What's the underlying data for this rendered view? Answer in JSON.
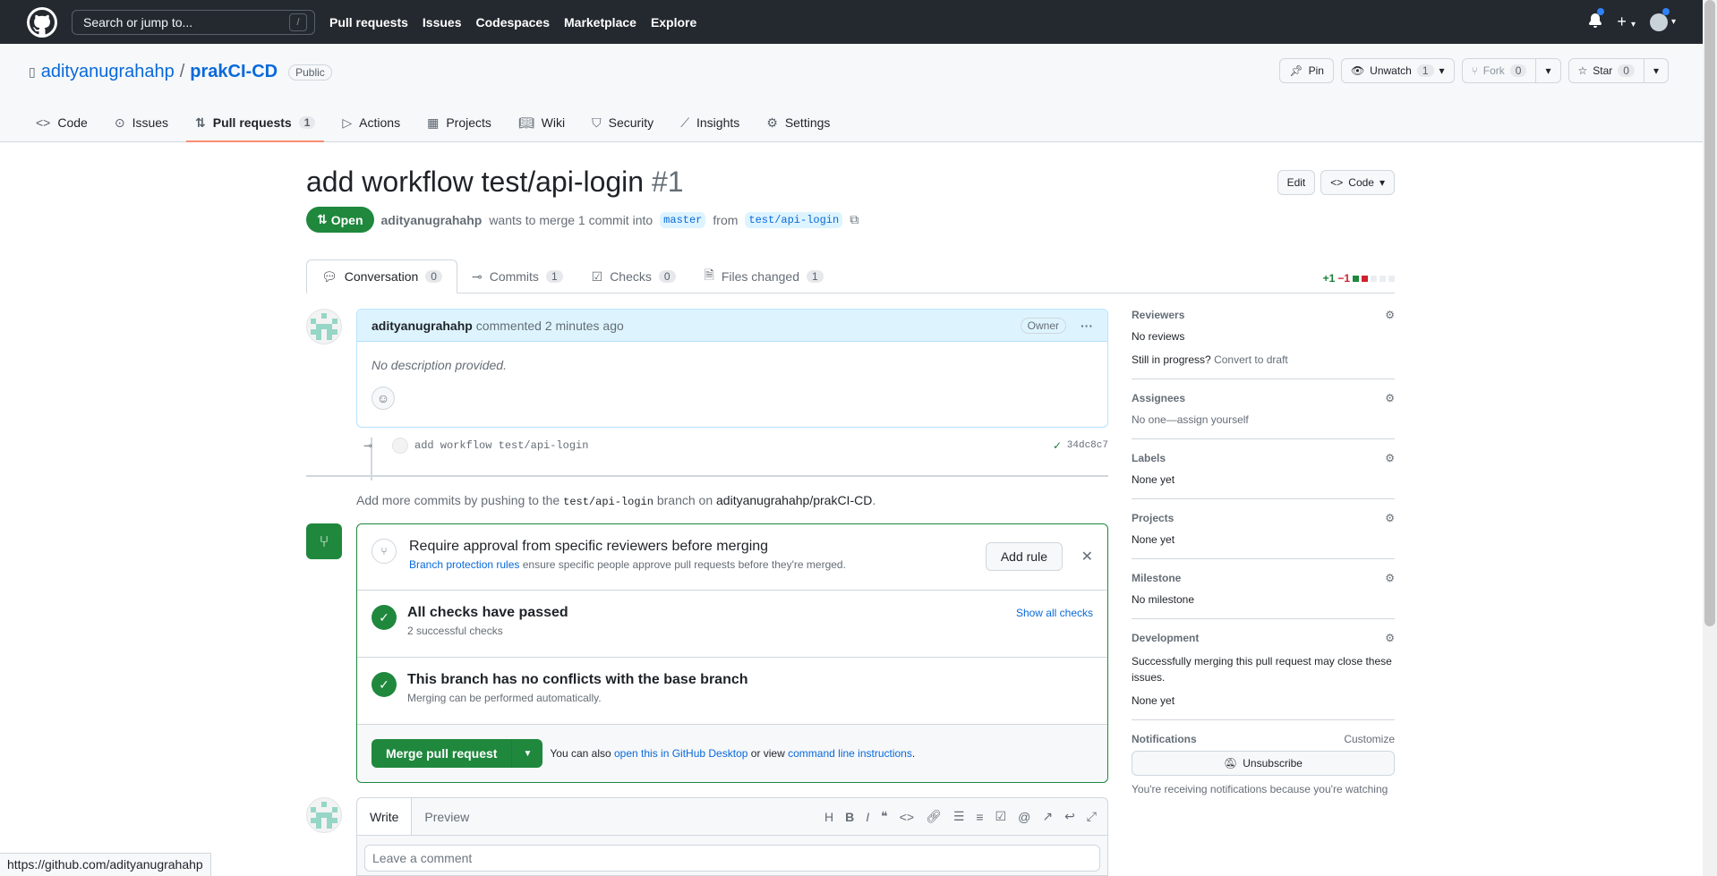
{
  "header": {
    "search_placeholder": "Search or jump to...",
    "search_key": "/",
    "nav": [
      "Pull requests",
      "Issues",
      "Codespaces",
      "Marketplace",
      "Explore"
    ]
  },
  "repo": {
    "owner": "adityanugrahahp",
    "name": "prakCI-CD",
    "visibility": "Public",
    "pin_label": "Pin",
    "watch_label": "Unwatch",
    "watch_count": "1",
    "fork_label": "Fork",
    "fork_count": "0",
    "star_label": "Star",
    "star_count": "0"
  },
  "tabs": [
    {
      "label": "Code"
    },
    {
      "label": "Issues"
    },
    {
      "label": "Pull requests",
      "count": "1"
    },
    {
      "label": "Actions"
    },
    {
      "label": "Projects"
    },
    {
      "label": "Wiki"
    },
    {
      "label": "Security"
    },
    {
      "label": "Insights"
    },
    {
      "label": "Settings"
    }
  ],
  "pr": {
    "title": "add workflow test/api-login",
    "number": "#1",
    "edit_label": "Edit",
    "code_label": "Code",
    "state": "Open",
    "author": "adityanugrahahp",
    "merge_text": "wants to merge 1 commit into",
    "base": "master",
    "from_text": "from",
    "head": "test/api-login",
    "tabs": [
      {
        "label": "Conversation",
        "count": "0"
      },
      {
        "label": "Commits",
        "count": "1"
      },
      {
        "label": "Checks",
        "count": "0"
      },
      {
        "label": "Files changed",
        "count": "1"
      }
    ],
    "diff_add": "+1",
    "diff_del": "−1"
  },
  "comment": {
    "author": "adityanugrahahp",
    "time": "commented 2 minutes ago",
    "badge": "Owner",
    "body": "No description provided."
  },
  "commit": {
    "message": "add workflow test/api-login",
    "sha": "34dc8c7"
  },
  "push_hint": {
    "prefix": "Add more commits by pushing to the",
    "branch": "test/api-login",
    "mid": "branch on",
    "repo": "adityanugrahahp/prakCI-CD",
    "suffix": "."
  },
  "mergebox": {
    "rule_title": "Require approval from specific reviewers before merging",
    "rule_link": "Branch protection rules",
    "rule_desc": "ensure specific people approve pull requests before they're merged.",
    "add_rule": "Add rule",
    "checks_title": "All checks have passed",
    "checks_sub": "2 successful checks",
    "show_checks": "Show all checks",
    "conflict_title": "This branch has no conflicts with the base branch",
    "conflict_sub": "Merging can be performed automatically.",
    "merge_button": "Merge pull request",
    "also_prefix": "You can also",
    "also_link1": "open this in GitHub Desktop",
    "also_mid": "or view",
    "also_link2": "command line instructions",
    "also_suffix": "."
  },
  "editor": {
    "write_tab": "Write",
    "preview_tab": "Preview",
    "placeholder": "Leave a comment"
  },
  "sidebar": {
    "reviewers_h": "Reviewers",
    "reviewers_v": "No reviews",
    "progress_q": "Still in progress?",
    "progress_link": "Convert to draft",
    "assignees_h": "Assignees",
    "assignees_v": "No one—",
    "assignees_link": "assign yourself",
    "labels_h": "Labels",
    "labels_v": "None yet",
    "projects_h": "Projects",
    "projects_v": "None yet",
    "milestone_h": "Milestone",
    "milestone_v": "No milestone",
    "development_h": "Development",
    "development_desc": "Successfully merging this pull request may close these issues.",
    "development_v": "None yet",
    "notifications_h": "Notifications",
    "customize": "Customize",
    "unsubscribe": "Unsubscribe",
    "notif_desc": "You're receiving notifications because you're watching"
  },
  "statusbar": "https://github.com/adityanugrahahp"
}
